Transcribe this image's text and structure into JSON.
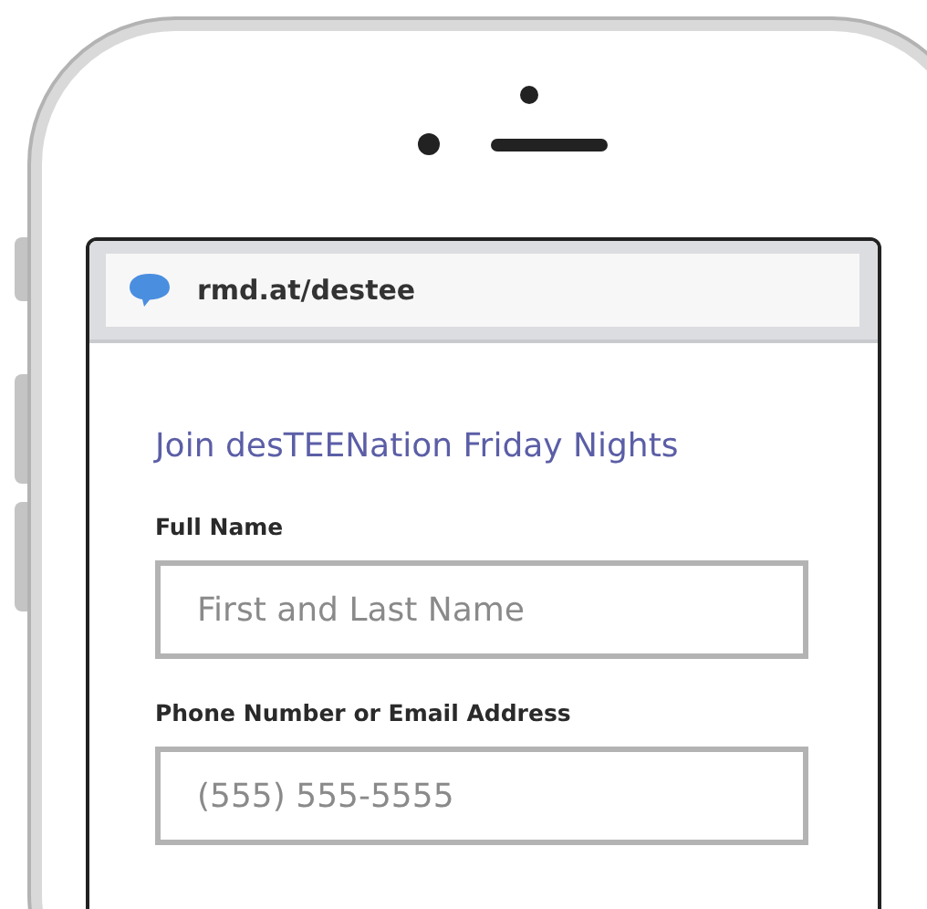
{
  "browser": {
    "url": "rmd.at/destee"
  },
  "form": {
    "title": "Join desTEENation Friday Nights",
    "fields": [
      {
        "label": "Full Name",
        "placeholder": "First and Last Name"
      },
      {
        "label": "Phone Number or Email Address",
        "placeholder": "(555) 555-5555"
      }
    ]
  }
}
